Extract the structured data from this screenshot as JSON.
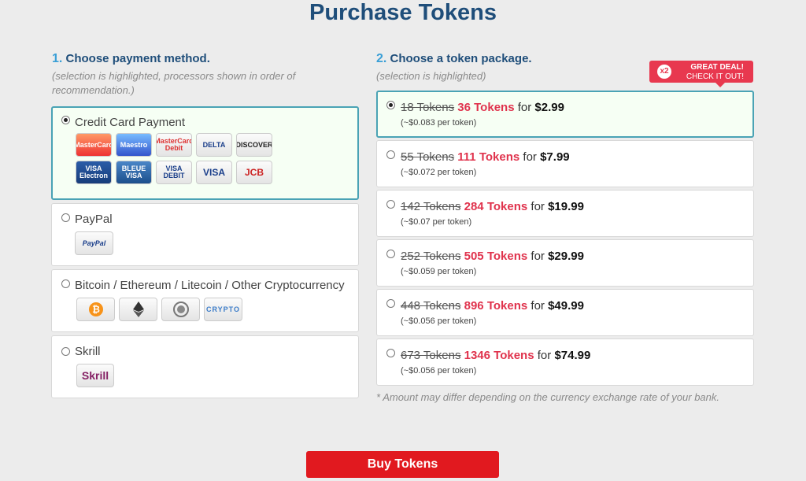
{
  "title": "Purchase Tokens",
  "payment": {
    "step": "1.",
    "heading": "Choose payment method.",
    "subtext": "(selection is highlighted, processors shown in order of recommendation.)",
    "options": [
      {
        "label": "Credit Card Payment",
        "selected": true,
        "icons": [
          "MasterCard",
          "Maestro",
          "MasterCard Debit",
          "DELTA",
          "DISCOVER",
          "VISA Electron",
          "BLEUE VISA",
          "VISA DEBIT",
          "VISA",
          "JCB"
        ]
      },
      {
        "label": "PayPal",
        "selected": false,
        "icons": [
          "PayPal"
        ]
      },
      {
        "label": "Bitcoin / Ethereum / Litecoin / Other Cryptocurrency",
        "selected": false,
        "icons": [
          "bitcoin-icon",
          "ethereum-icon",
          "litecoin-icon",
          "CRYPTO"
        ]
      },
      {
        "label": "Skrill",
        "selected": false,
        "icons": [
          "Skrill"
        ]
      }
    ]
  },
  "packages": {
    "step": "2.",
    "heading": "Choose a token package.",
    "subtext": "(selection is highlighted)",
    "deal_badge": {
      "multiplier": "x2",
      "line1": "GREAT DEAL!",
      "line2": "CHECK IT OUT!"
    },
    "for_word": "for",
    "items": [
      {
        "old": "18 Tokens",
        "new": "36 Tokens",
        "price": "$2.99",
        "per": "(~$0.083 per token)",
        "selected": true
      },
      {
        "old": "55 Tokens",
        "new": "111 Tokens",
        "price": "$7.99",
        "per": "(~$0.072 per token)",
        "selected": false
      },
      {
        "old": "142 Tokens",
        "new": "284 Tokens",
        "price": "$19.99",
        "per": "(~$0.07 per token)",
        "selected": false
      },
      {
        "old": "252 Tokens",
        "new": "505 Tokens",
        "price": "$29.99",
        "per": "(~$0.059 per token)",
        "selected": false
      },
      {
        "old": "448 Tokens",
        "new": "896 Tokens",
        "price": "$49.99",
        "per": "(~$0.056 per token)",
        "selected": false
      },
      {
        "old": "673 Tokens",
        "new": "1346 Tokens",
        "price": "$74.99",
        "per": "(~$0.056 per token)",
        "selected": false
      }
    ],
    "note": "* Amount may differ depending on the currency exchange rate of your bank."
  },
  "buy_button": "Buy Tokens",
  "colors": {
    "accent": "#1f4e7a",
    "highlight": "#e0334d",
    "button": "#e1191f",
    "selected_border": "#4aa3b5"
  }
}
